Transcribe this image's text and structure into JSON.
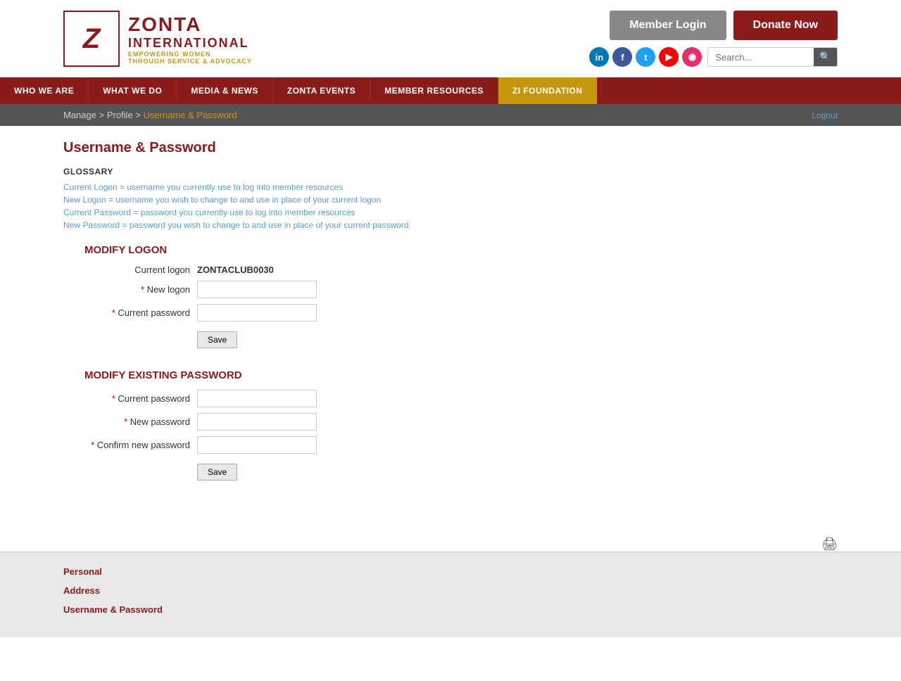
{
  "header": {
    "logo": {
      "z_letter": "Z",
      "zonta": "ZONTA",
      "international": "INTERNATIONAL",
      "tagline_line1": "EMPOWERING WOMEN",
      "tagline_line2": "THROUGH SERVICE & ADVOCACY"
    },
    "buttons": {
      "member_login": "Member Login",
      "donate_now": "Donate Now"
    },
    "social": {
      "linkedin": "in",
      "facebook": "f",
      "twitter": "t",
      "youtube": "▶",
      "instagram": "◉"
    },
    "search_placeholder": "Search..."
  },
  "nav": {
    "items": [
      {
        "id": "who-we-are",
        "label": "WHO WE ARE",
        "active": false
      },
      {
        "id": "what-we-do",
        "label": "WHAT WE DO",
        "active": false
      },
      {
        "id": "media-news",
        "label": "MEDIA & NEWS",
        "active": false
      },
      {
        "id": "zonta-events",
        "label": "ZONTA EVENTS",
        "active": false
      },
      {
        "id": "member-resources",
        "label": "MEMBER RESOURCES",
        "active": false
      },
      {
        "id": "zi-foundation",
        "label": "ZI FOUNDATION",
        "active": true
      }
    ]
  },
  "breadcrumb": {
    "manage": "Manage",
    "profile": "Profile",
    "current": "Username & Password",
    "logout": "Logout"
  },
  "page": {
    "title": "Username & Password",
    "glossary_label": "GLOSSARY",
    "glossary_items": [
      "Current Logon = username you currently use to log into member resources",
      "New Logon = username you wish to change to and use in place of your current logon",
      "Current Password = password you currently use to log into member resources",
      "New Password = password you wish to change to and use in place of your current password"
    ],
    "modify_logon": {
      "title": "MODIFY LOGON",
      "current_logon_label": "Current logon",
      "current_logon_value": "ZONTACLUB0030",
      "new_logon_label": "New logon",
      "current_password_label": "Current password",
      "save_label": "Save"
    },
    "modify_password": {
      "title": "MODIFY EXISTING PASSWORD",
      "current_password_label": "Current password",
      "new_password_label": "New password",
      "confirm_password_label": "Confirm new password",
      "save_label": "Save"
    }
  },
  "footer": {
    "links": [
      "Personal",
      "Address",
      "Username & Password"
    ]
  }
}
